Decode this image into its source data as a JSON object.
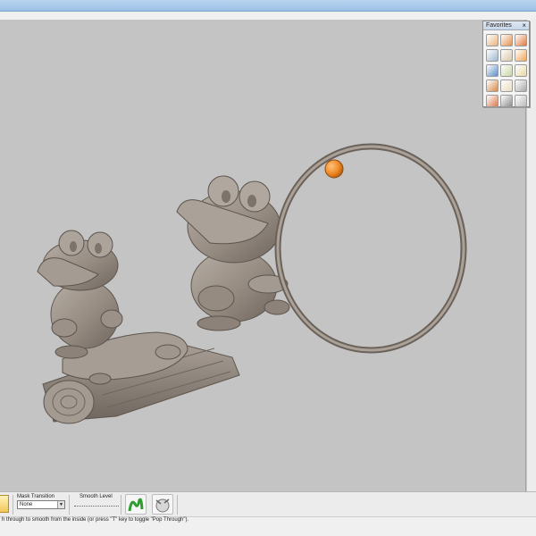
{
  "favorites": {
    "title": "Favorites",
    "close_glyph": "×",
    "tools": [
      {
        "icon": "clay-tool-icon",
        "color": "#e9b27b"
      },
      {
        "icon": "blob-tool-icon",
        "color": "#e48f4d"
      },
      {
        "icon": "smooth-tool-icon",
        "color": "#e07a3f"
      },
      {
        "icon": "sphere-tool-icon",
        "color": "#9db7cf"
      },
      {
        "icon": "carve-tool-icon",
        "color": "#d8c7a6"
      },
      {
        "icon": "inflate-tool-icon",
        "color": "#f0a65a"
      },
      {
        "icon": "globe-tool-icon",
        "color": "#5d8fc6"
      },
      {
        "icon": "brush-tool-icon",
        "color": "#c8d7a3"
      },
      {
        "icon": "cube-tool-icon",
        "color": "#e8d7a6"
      },
      {
        "icon": "figure-tool-icon",
        "color": "#d48a4a"
      },
      {
        "icon": "paint-tool-icon",
        "color": "#e8dcc1"
      },
      {
        "icon": "lock-tool-icon",
        "color": "#a8a8a8"
      },
      {
        "icon": "mirror-tool-icon",
        "color": "#d97b4f"
      },
      {
        "icon": "mask-tool-icon",
        "color": "#8d8d8d"
      },
      {
        "icon": "anchor-tool-icon",
        "color": "#b9b9b9"
      }
    ]
  },
  "toolbar": {
    "mask_transition_label": "Mask Transition",
    "mask_transition_value": "None",
    "smooth_level_label": "Smooth Level"
  },
  "status": {
    "text": "h through to smooth from the inside (or press \"T\" key to toggle \"Pop Through\")."
  },
  "colors": {
    "viewport_bg": "#c4c4c4",
    "model": "#9c9288",
    "model_dark": "#6f665e",
    "orange_ball": "#f08a28"
  }
}
